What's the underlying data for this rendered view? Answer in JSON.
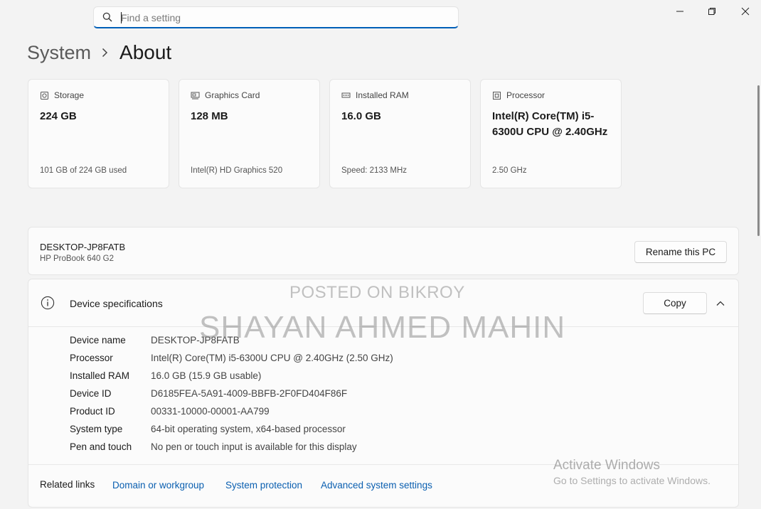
{
  "search": {
    "placeholder": "Find a setting"
  },
  "breadcrumb": {
    "parent": "System",
    "current": "About"
  },
  "cards": [
    {
      "icon": "storage-icon",
      "title": "Storage",
      "value": "224 GB",
      "sub": "101 GB of 224 GB used"
    },
    {
      "icon": "graphics-card-icon",
      "title": "Graphics Card",
      "value": "128 MB",
      "sub": "Intel(R) HD Graphics 520"
    },
    {
      "icon": "ram-icon",
      "title": "Installed RAM",
      "value": "16.0 GB",
      "sub": "Speed: 2133 MHz"
    },
    {
      "icon": "processor-icon",
      "title": "Processor",
      "value": "Intel(R) Core(TM) i5-6300U CPU @ 2.40GHz",
      "sub": "2.50 GHz"
    }
  ],
  "pc": {
    "name": "DESKTOP-JP8FATB",
    "model": "HP ProBook 640 G2",
    "rename_label": "Rename this PC"
  },
  "spec": {
    "title": "Device specifications",
    "copy_label": "Copy",
    "rows": [
      {
        "k": "Device name",
        "v": "DESKTOP-JP8FATB"
      },
      {
        "k": "Processor",
        "v": "Intel(R) Core(TM) i5-6300U CPU @ 2.40GHz (2.50 GHz)"
      },
      {
        "k": "Installed RAM",
        "v": "16.0 GB (15.9 GB usable)"
      },
      {
        "k": "Device ID",
        "v": "D6185FEA-5A91-4009-BBFB-2F0FD404F86F"
      },
      {
        "k": "Product ID",
        "v": "00331-10000-00001-AA799"
      },
      {
        "k": "System type",
        "v": "64-bit operating system, x64-based processor"
      },
      {
        "k": "Pen and touch",
        "v": "No pen or touch input is available for this display"
      }
    ]
  },
  "related": {
    "label": "Related links",
    "links": [
      "Domain or workgroup",
      "System protection",
      "Advanced system settings"
    ]
  },
  "watermark": {
    "line1": "POSTED ON BIKROY",
    "line2": "SHAYAN AHMED MAHIN"
  },
  "activation": {
    "title": "Activate Windows",
    "sub": "Go to Settings to activate Windows."
  },
  "colors": {
    "accent": "#005fb8",
    "link": "#0a5fb0",
    "background": "#f3f3f3"
  }
}
